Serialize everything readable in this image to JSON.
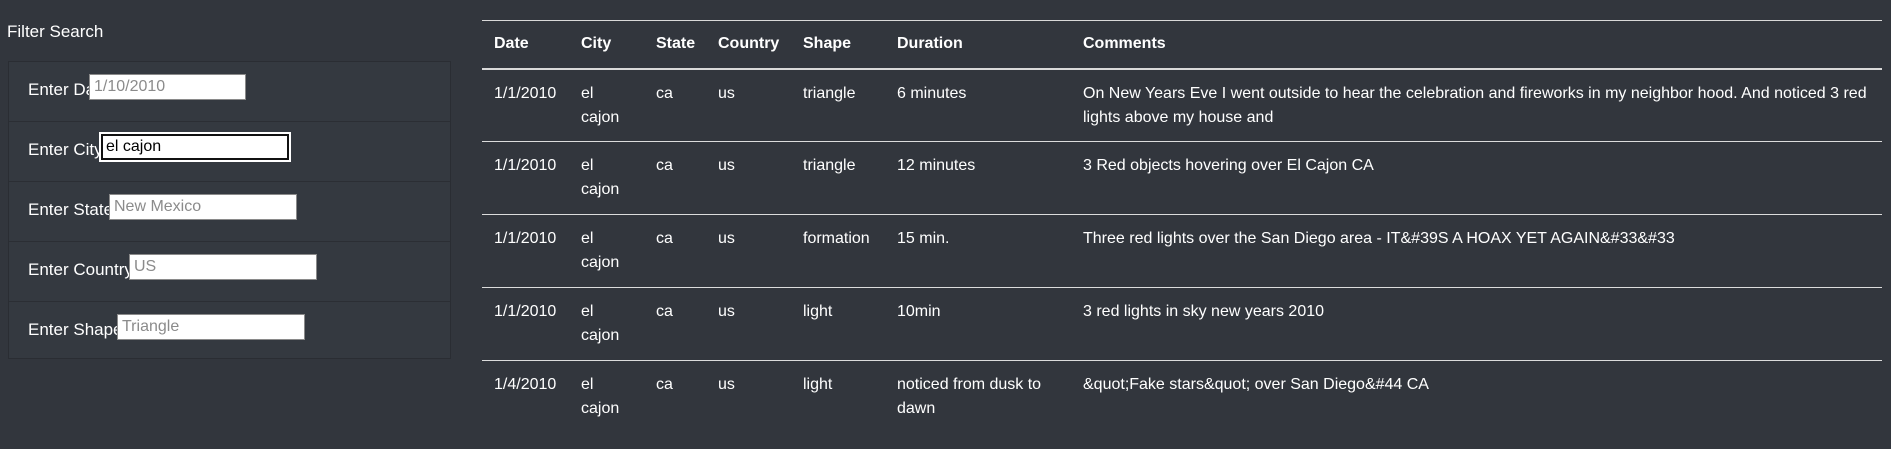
{
  "filter": {
    "title": "Filter Search",
    "fields": [
      {
        "label": "Enter Date",
        "value": "",
        "placeholder": "1/10/2010"
      },
      {
        "label": "Enter City",
        "value": "el cajon",
        "placeholder": ""
      },
      {
        "label": "Enter State",
        "value": "",
        "placeholder": "New Mexico"
      },
      {
        "label": "Enter Country",
        "value": "",
        "placeholder": "US"
      },
      {
        "label": "Enter Shape",
        "value": "",
        "placeholder": "Triangle"
      }
    ]
  },
  "table": {
    "headers": [
      "Date",
      "City",
      "State",
      "Country",
      "Shape",
      "Duration",
      "Comments"
    ],
    "rows": [
      [
        "1/1/2010",
        "el cajon",
        "ca",
        "us",
        "triangle",
        "6 minutes",
        "On New Years Eve I went outside to hear the celebration and fireworks in my neighbor hood. And noticed 3 red lights above my house and"
      ],
      [
        "1/1/2010",
        "el cajon",
        "ca",
        "us",
        "triangle",
        "12 minutes",
        "3 Red objects hovering over El Cajon CA"
      ],
      [
        "1/1/2010",
        "el cajon",
        "ca",
        "us",
        "formation",
        "15 min.",
        "Three red lights over the San Diego area - IT&#39S A HOAX YET AGAIN&#33&#33"
      ],
      [
        "1/1/2010",
        "el cajon",
        "ca",
        "us",
        "light",
        "10min",
        "3 red lights in sky new years 2010"
      ],
      [
        "1/4/2010",
        "el cajon",
        "ca",
        "us",
        "light",
        "noticed from dusk to dawn",
        "&quot;Fake stars&quot; over San Diego&#44 CA"
      ]
    ]
  }
}
